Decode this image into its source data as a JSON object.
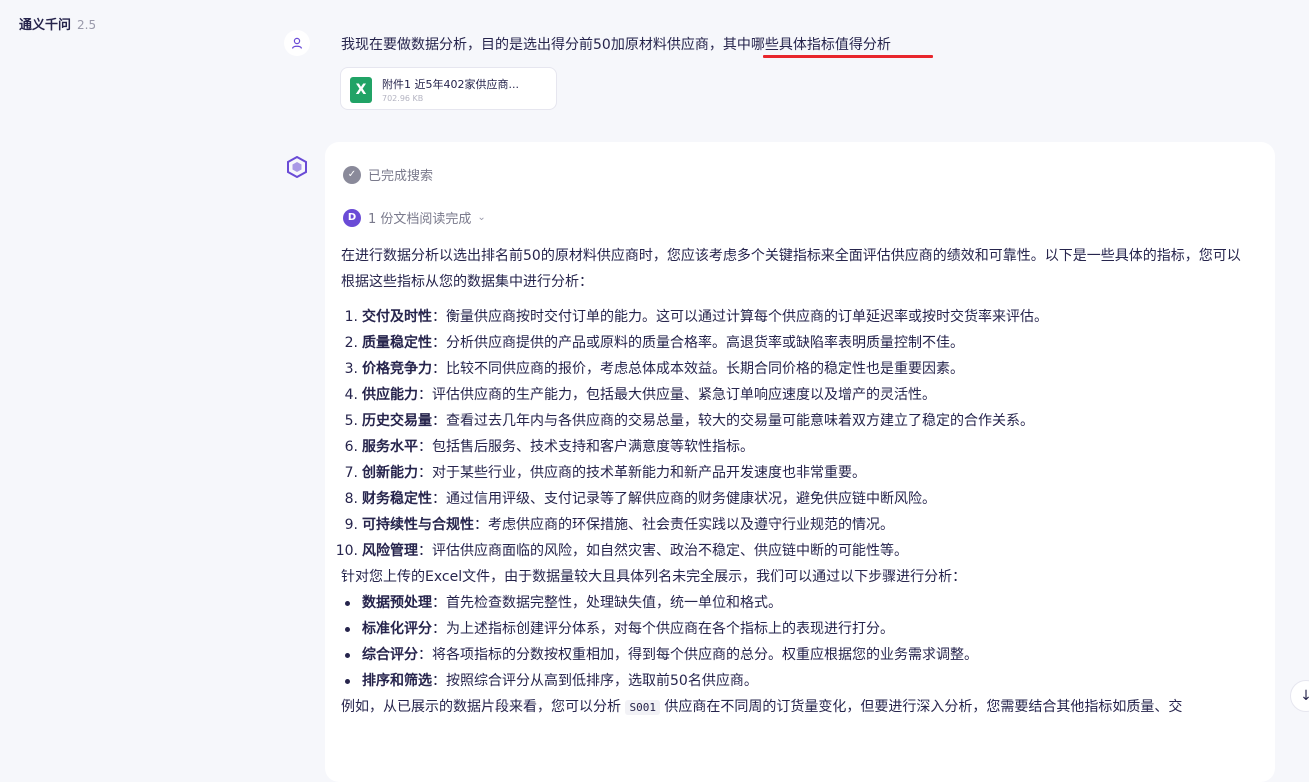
{
  "app": {
    "name": "通义千问",
    "version": "2.5"
  },
  "user_message": {
    "text_main": "我现在要做数据分析，目的是选出得分前50加原材料供应商，",
    "text_highlight": "其中哪些具体指标值得分析",
    "attachment": {
      "icon": "excel-icon",
      "icon_letter": "X",
      "name": "附件1 近5年402家供应商...",
      "size": "702.96 KB"
    }
  },
  "assistant": {
    "search_status": "已完成搜索",
    "doc_status": "1 份文档阅读完成",
    "doc_icon_letter": "D",
    "intro": "在进行数据分析以选出排名前50的原材料供应商时，您应该考虑多个关键指标来全面评估供应商的绩效和可靠性。以下是一些具体的指标，您可以根据这些指标从您的数据集中进行分析：",
    "metrics": [
      {
        "num": "1.",
        "title": "交付及时性",
        "desc": "：衡量供应商按时交付订单的能力。这可以通过计算每个供应商的订单延迟率或按时交货率来评估。"
      },
      {
        "num": "2.",
        "title": "质量稳定性",
        "desc": "：分析供应商提供的产品或原料的质量合格率。高退货率或缺陷率表明质量控制不佳。"
      },
      {
        "num": "3.",
        "title": "价格竞争力",
        "desc": "：比较不同供应商的报价，考虑总体成本效益。长期合同价格的稳定性也是重要因素。"
      },
      {
        "num": "4.",
        "title": "供应能力",
        "desc": "：评估供应商的生产能力，包括最大供应量、紧急订单响应速度以及增产的灵活性。"
      },
      {
        "num": "5.",
        "title": "历史交易量",
        "desc": "：查看过去几年内与各供应商的交易总量，较大的交易量可能意味着双方建立了稳定的合作关系。"
      },
      {
        "num": "6.",
        "title": "服务水平",
        "desc": "：包括售后服务、技术支持和客户满意度等软性指标。"
      },
      {
        "num": "7.",
        "title": "创新能力",
        "desc": "：对于某些行业，供应商的技术革新能力和新产品开发速度也非常重要。"
      },
      {
        "num": "8.",
        "title": "财务稳定性",
        "desc": "：通过信用评级、支付记录等了解供应商的财务健康状况，避免供应链中断风险。"
      },
      {
        "num": "9.",
        "title": "可持续性与合规性",
        "desc": "：考虑供应商的环保措施、社会责任实践以及遵守行业规范的情况。"
      },
      {
        "num": "10.",
        "title": "风险管理",
        "desc": "：评估供应商面临的风险，如自然灾害、政治不稳定、供应链中断的可能性等。"
      }
    ],
    "para2": "针对您上传的Excel文件，由于数据量较大且具体列名未完全展示，我们可以通过以下步骤进行分析：",
    "steps": [
      {
        "title": "数据预处理",
        "desc": "：首先检查数据完整性，处理缺失值，统一单位和格式。"
      },
      {
        "title": "标准化评分",
        "desc": "：为上述指标创建评分体系，对每个供应商在各个指标上的表现进行打分。"
      },
      {
        "title": "综合评分",
        "desc": "：将各项指标的分数按权重相加，得到每个供应商的总分。权重应根据您的业务需求调整。"
      },
      {
        "title": "排序和筛选",
        "desc": "：按照综合评分从高到低排序，选取前50名供应商。"
      }
    ],
    "final_before": "例如，从已展示的数据片段来看，您可以分析",
    "final_code": "S001",
    "final_after": "供应商在不同周的订货量变化，但要进行深入分析，您需要结合其他指标如质量、交"
  },
  "scroll_button": {
    "glyph": "↓"
  },
  "colors": {
    "accent": "#6a4bd6",
    "underline": "#e8262c",
    "excel": "#21a366"
  }
}
